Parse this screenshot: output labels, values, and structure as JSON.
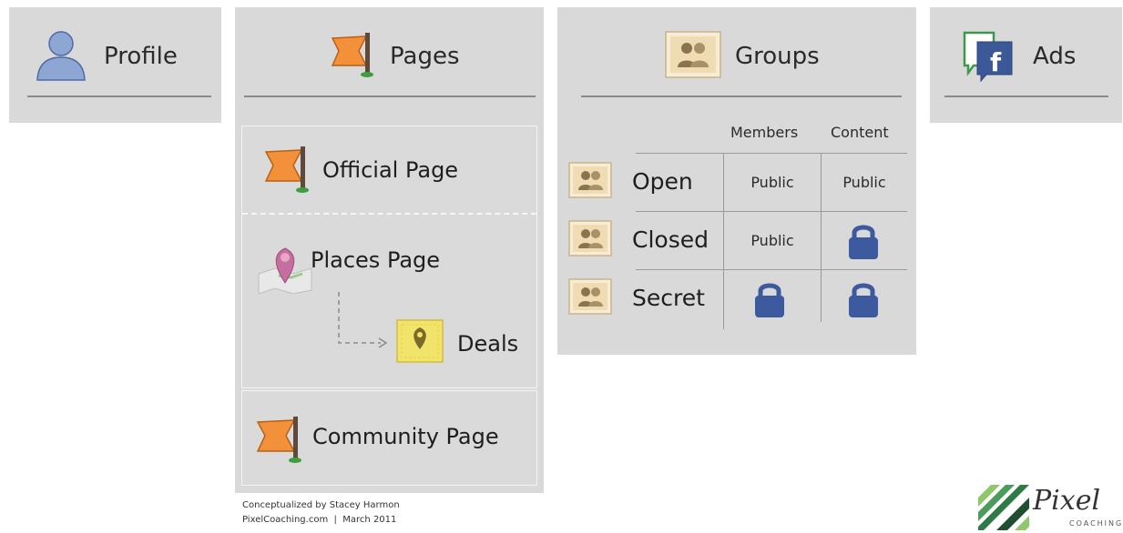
{
  "colors": {
    "panel_bg": "#d9d9d9",
    "flag_orange": "#f2913a",
    "lock_blue": "#3d5a9e",
    "profile_blue": "#7e97c9",
    "deal_yellow": "#f2e36b",
    "logo_green": "#2f7a47"
  },
  "profile": {
    "title": "Profile",
    "icon": "person-silhouette-icon"
  },
  "pages": {
    "title": "Pages",
    "icon": "orange-flag-icon",
    "official": "Official Page",
    "places": "Places Page",
    "deals": "Deals",
    "community": "Community Page"
  },
  "groups": {
    "title": "Groups",
    "icon": "group-icon",
    "columns": [
      "Members",
      "Content"
    ],
    "rows": [
      {
        "label": "Open",
        "members": "Public",
        "content": "Public"
      },
      {
        "label": "Closed",
        "members": "Public",
        "content": "lock"
      },
      {
        "label": "Secret",
        "members": "lock",
        "content": "lock"
      }
    ]
  },
  "ads": {
    "title": "Ads",
    "icon": "facebook-ads-icon"
  },
  "footer": {
    "line1": "Conceptualized by Stacey Harmon",
    "line2": "PixelCoaching.com  |  March 2011"
  },
  "logo": {
    "name": "Pixel",
    "tagline": "COACHING"
  }
}
